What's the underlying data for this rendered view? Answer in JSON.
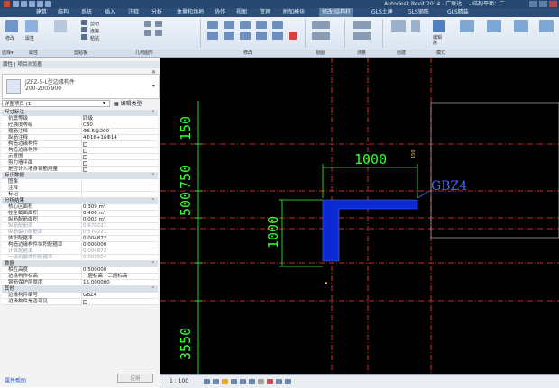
{
  "window": {
    "title": "Autodesk Revit 2014 - 广联达... - 结构平面：二"
  },
  "menu": {
    "tabs": [
      "建筑",
      "结构",
      "系统",
      "插入",
      "注释",
      "分析",
      "体量和场地",
      "协作",
      "视图",
      "管理",
      "附加模块",
      "修改|结构柱",
      "GLS土建",
      "GLS钢筋",
      "GLS精装"
    ]
  },
  "ribbon": {
    "modify_label": "修改",
    "properties_label": "属性",
    "groups": [
      "选择▾",
      "属性",
      "剪贴板",
      "几何图形",
      "修改",
      "视图",
      "测量",
      "创建",
      "模式"
    ],
    "edit_label": "编辑\n族",
    "tools": [
      "剪切",
      "连接",
      "粘贴",
      "复制",
      "拆分",
      "对齐",
      "阵列",
      "镜像",
      "删除"
    ]
  },
  "panel": {
    "header": "属性 | 项目浏览器",
    "type_name_line1": "JZFZ-5-L型边缘构件",
    "type_name_line2": "200-200x900",
    "instance_label": "详图项目 (1)",
    "edit_type": "编辑类型",
    "sections": [
      {
        "title": "尺寸标注",
        "rows": [
          {
            "k": "抗震等级",
            "v": "四级"
          },
          {
            "k": "砼强度等级",
            "v": "C30"
          },
          {
            "k": "箍筋注释",
            "v": "Φ6.5@200"
          },
          {
            "k": "纵筋注释",
            "v": "4Φ16+16Φ14"
          },
          {
            "k": "构造边缘构件",
            "cb": true
          },
          {
            "k": "构造边缘构件",
            "cb": true
          },
          {
            "k": "示意图",
            "cb": true
          },
          {
            "k": "剪力墙平面",
            "cb": true
          },
          {
            "k": "是否计入墙身钢筋用量",
            "cb": true
          }
        ]
      },
      {
        "title": "标识数据",
        "rows": [
          {
            "k": "图像",
            "v": ""
          },
          {
            "k": "注释",
            "v": ""
          },
          {
            "k": "标记",
            "v": ""
          }
        ]
      },
      {
        "title": "分析结果",
        "rows": [
          {
            "k": "核心区面积",
            "v": "0.309 m²"
          },
          {
            "k": "柱全截面面积",
            "v": "0.400 m²"
          },
          {
            "k": "纵筋配筋面积",
            "v": "0.003 m²"
          },
          {
            "k": "纵筋配筋率",
            "v": "0.970221",
            "dim": true
          },
          {
            "k": "纵筋最小配筋率",
            "v": "0.570221",
            "dim": true
          },
          {
            "k": "体积配箍率",
            "v": "0.004872"
          },
          {
            "k": "构造边缘构件体积配箍率",
            "v": "0.000000"
          },
          {
            "k": "计算配箍率",
            "v": "0.004872",
            "dim": true
          },
          {
            "k": "一级抗震体积配箍率",
            "v": "0.003504",
            "dim": true
          }
        ]
      },
      {
        "title": "数据",
        "rows": [
          {
            "k": "相互高度",
            "v": "0.500000"
          },
          {
            "k": "边缘构件标高",
            "v": "一层标高 - 三层标高"
          },
          {
            "k": "钢筋保护层厚度",
            "v": "15.000000"
          }
        ]
      },
      {
        "title": "其他",
        "rows": [
          {
            "k": "边缘构件编号",
            "v": "GBZ4"
          },
          {
            "k": "边缘构件是否可见",
            "cb": true
          }
        ]
      }
    ],
    "help": "属性帮助",
    "apply": "应用"
  },
  "drawing": {
    "dims": [
      "150",
      "750",
      "500",
      "3550",
      "1000",
      "1000",
      "150"
    ],
    "tag": "GBZ4",
    "column_color": "#0a2bd4",
    "dim_color": "#33ff33",
    "grid_color": "#ff3b3b"
  },
  "status": {
    "scale": "1 : 100"
  }
}
